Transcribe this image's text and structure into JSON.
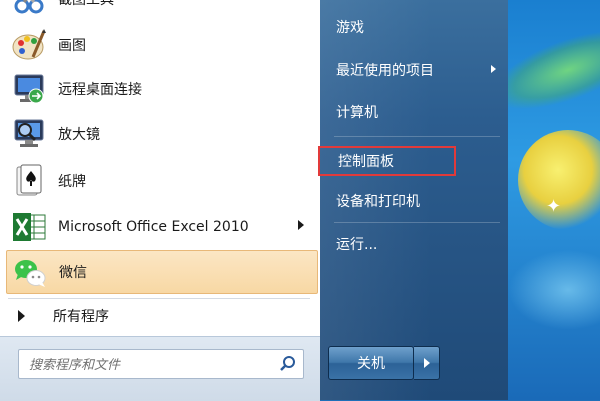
{
  "programs": [
    {
      "label": "截图工具",
      "icon": "snipping-tool-icon"
    },
    {
      "label": "画图",
      "icon": "paint-icon"
    },
    {
      "label": "远程桌面连接",
      "icon": "remote-desktop-icon"
    },
    {
      "label": "放大镜",
      "icon": "magnifier-icon"
    },
    {
      "label": "纸牌",
      "icon": "solitaire-icon"
    },
    {
      "label": "Microsoft Office Excel 2010",
      "icon": "excel-icon",
      "has_submenu": true
    },
    {
      "label": "微信",
      "icon": "wechat-icon",
      "highlighted": true
    }
  ],
  "all_programs_label": "所有程序",
  "search": {
    "placeholder": "搜索程序和文件"
  },
  "right_items": [
    {
      "label": "游戏"
    },
    {
      "label": "最近使用的项目",
      "has_submenu": true
    },
    {
      "label": "计算机"
    },
    {
      "label": "控制面板",
      "boxed": true
    },
    {
      "label": "设备和打印机"
    },
    {
      "label": "运行..."
    }
  ],
  "shutdown": {
    "label": "关机"
  },
  "colors": {
    "highlight_box": "#e23a3a",
    "hover_orange": "#f8d8a4",
    "right_pane": "#2c5d8f"
  }
}
